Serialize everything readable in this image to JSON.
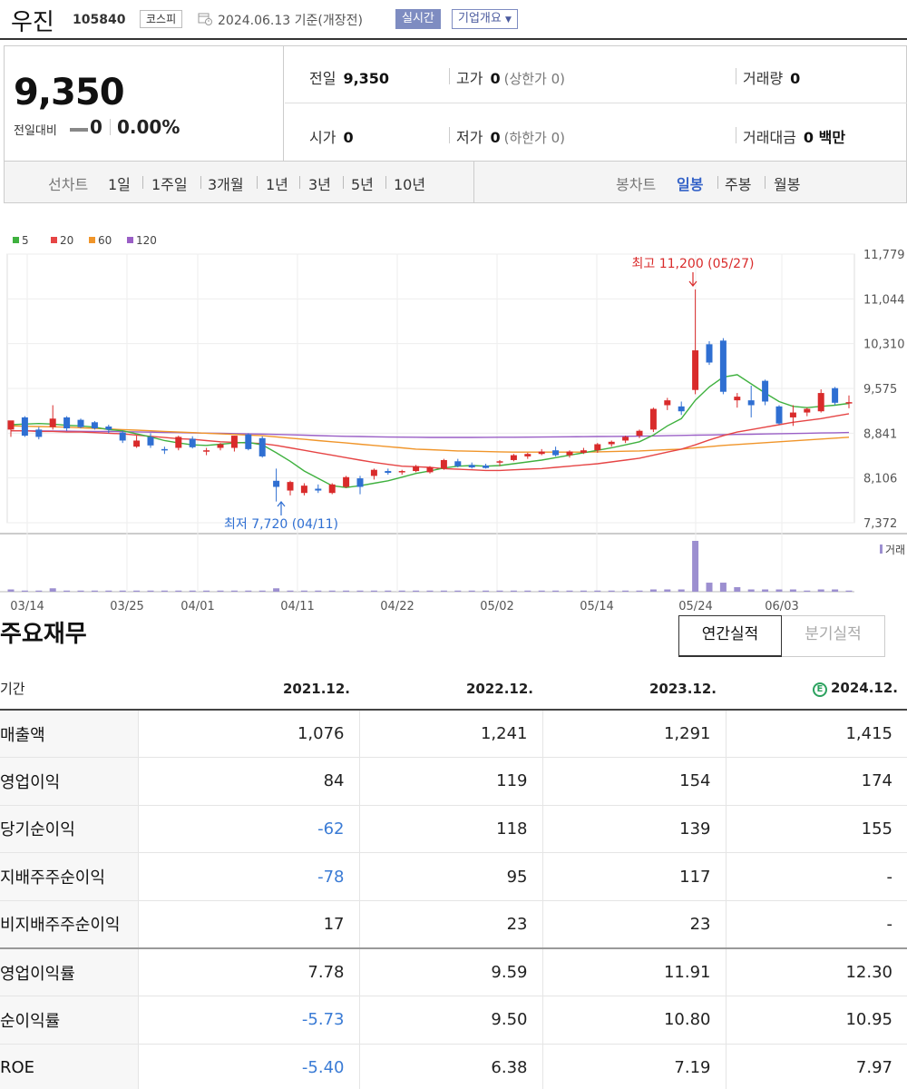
{
  "header": {
    "name": "우진",
    "code": "105840",
    "market": "코스피",
    "date": "2024.06.13",
    "basis": "기준(개장전)",
    "realtime": "실시간",
    "corp_info": "기업개요"
  },
  "price": {
    "current": "9,350",
    "change_label": "전일대비",
    "change": "0",
    "change_pct": "0.00%",
    "prev_label": "전일",
    "prev": "9,350",
    "high_label": "고가",
    "high": "0",
    "upper_limit": "(상한가 0)",
    "volume_label": "거래량",
    "volume": "0",
    "open_label": "시가",
    "open": "0",
    "low_label": "저가",
    "low": "0",
    "lower_limit": "(하한가 0)",
    "amount_label": "거래대금",
    "amount": "0 백만"
  },
  "chart_tabs": {
    "line_label": "선차트",
    "line_periods": [
      "1일",
      "1주일",
      "3개월",
      "1년",
      "3년",
      "5년",
      "10년"
    ],
    "candle_label": "봉차트",
    "candle_periods": [
      "일봉",
      "주봉",
      "월봉"
    ],
    "candle_selected": 0
  },
  "colors": {
    "up": "#d92b2b",
    "down": "#2f6fd2",
    "ma5": "#3fb13f",
    "ma20": "#e64545",
    "ma60": "#f0952a",
    "ma120": "#9a5fc6",
    "volume": "#9c8fd0"
  },
  "chart_data": {
    "type": "candlestick",
    "legend": [
      {
        "name": "5",
        "color": "#3fb13f"
      },
      {
        "name": "20",
        "color": "#e64545"
      },
      {
        "name": "60",
        "color": "#f0952a"
      },
      {
        "name": "120",
        "color": "#9a5fc6"
      }
    ],
    "y_ticks": [
      "11,779",
      "11,044",
      "10,310",
      "9,575",
      "8,841",
      "8,106",
      "7,372"
    ],
    "ylim": [
      7372,
      11779
    ],
    "x_ticks": [
      "03/14",
      "03/25",
      "04/01",
      "04/11",
      "04/22",
      "05/02",
      "05/14",
      "05/24",
      "06/03"
    ],
    "annotations": {
      "high": "최고 11,200 (05/27)",
      "low": "최저 7,720 (04/11)"
    },
    "volume_label": "거래",
    "candles": [
      {
        "o": 8900,
        "h": 9040,
        "l": 8780,
        "c": 9050
      },
      {
        "o": 9100,
        "h": 9120,
        "l": 8780,
        "c": 8800
      },
      {
        "o": 8900,
        "h": 8940,
        "l": 8740,
        "c": 8780
      },
      {
        "o": 8940,
        "h": 9300,
        "l": 8900,
        "c": 9080
      },
      {
        "o": 9100,
        "h": 9120,
        "l": 8880,
        "c": 8920
      },
      {
        "o": 9060,
        "h": 9080,
        "l": 8920,
        "c": 8940
      },
      {
        "o": 9020,
        "h": 9040,
        "l": 8900,
        "c": 8920
      },
      {
        "o": 8950,
        "h": 8980,
        "l": 8840,
        "c": 8900
      },
      {
        "o": 8850,
        "h": 8880,
        "l": 8680,
        "c": 8720
      },
      {
        "o": 8620,
        "h": 8800,
        "l": 8600,
        "c": 8720
      },
      {
        "o": 8780,
        "h": 8840,
        "l": 8600,
        "c": 8640
      },
      {
        "o": 8580,
        "h": 8620,
        "l": 8500,
        "c": 8560
      },
      {
        "o": 8600,
        "h": 8800,
        "l": 8560,
        "c": 8780
      },
      {
        "o": 8750,
        "h": 8790,
        "l": 8590,
        "c": 8610
      },
      {
        "o": 8540,
        "h": 8600,
        "l": 8480,
        "c": 8560
      },
      {
        "o": 8600,
        "h": 8680,
        "l": 8560,
        "c": 8660
      },
      {
        "o": 8600,
        "h": 8800,
        "l": 8540,
        "c": 8800
      },
      {
        "o": 8820,
        "h": 8840,
        "l": 8560,
        "c": 8580
      },
      {
        "o": 8760,
        "h": 8790,
        "l": 8440,
        "c": 8460
      },
      {
        "o": 8060,
        "h": 8260,
        "l": 7720,
        "c": 7960
      },
      {
        "o": 7900,
        "h": 8060,
        "l": 7820,
        "c": 8040
      },
      {
        "o": 7860,
        "h": 8020,
        "l": 7820,
        "c": 7980
      },
      {
        "o": 7930,
        "h": 8000,
        "l": 7860,
        "c": 7900
      },
      {
        "o": 7860,
        "h": 8020,
        "l": 7840,
        "c": 8000
      },
      {
        "o": 7960,
        "h": 8140,
        "l": 7940,
        "c": 8120
      },
      {
        "o": 8100,
        "h": 8140,
        "l": 7840,
        "c": 7960
      },
      {
        "o": 8140,
        "h": 8260,
        "l": 8080,
        "c": 8240
      },
      {
        "o": 8220,
        "h": 8260,
        "l": 8160,
        "c": 8190
      },
      {
        "o": 8200,
        "h": 8240,
        "l": 8160,
        "c": 8220
      },
      {
        "o": 8220,
        "h": 8320,
        "l": 8200,
        "c": 8300
      },
      {
        "o": 8200,
        "h": 8300,
        "l": 8180,
        "c": 8280
      },
      {
        "o": 8260,
        "h": 8420,
        "l": 8240,
        "c": 8400
      },
      {
        "o": 8380,
        "h": 8420,
        "l": 8280,
        "c": 8300
      },
      {
        "o": 8320,
        "h": 8360,
        "l": 8260,
        "c": 8280
      },
      {
        "o": 8310,
        "h": 8340,
        "l": 8260,
        "c": 8270
      },
      {
        "o": 8360,
        "h": 8400,
        "l": 8300,
        "c": 8380
      },
      {
        "o": 8400,
        "h": 8500,
        "l": 8380,
        "c": 8480
      },
      {
        "o": 8460,
        "h": 8520,
        "l": 8420,
        "c": 8500
      },
      {
        "o": 8500,
        "h": 8580,
        "l": 8480,
        "c": 8540
      },
      {
        "o": 8560,
        "h": 8620,
        "l": 8460,
        "c": 8480
      },
      {
        "o": 8480,
        "h": 8560,
        "l": 8440,
        "c": 8540
      },
      {
        "o": 8520,
        "h": 8600,
        "l": 8500,
        "c": 8560
      },
      {
        "o": 8560,
        "h": 8680,
        "l": 8520,
        "c": 8660
      },
      {
        "o": 8660,
        "h": 8720,
        "l": 8620,
        "c": 8700
      },
      {
        "o": 8720,
        "h": 8800,
        "l": 8680,
        "c": 8780
      },
      {
        "o": 8800,
        "h": 8900,
        "l": 8760,
        "c": 8880
      },
      {
        "o": 8900,
        "h": 9260,
        "l": 8860,
        "c": 9240
      },
      {
        "o": 9300,
        "h": 9420,
        "l": 9220,
        "c": 9380
      },
      {
        "o": 9280,
        "h": 9360,
        "l": 9140,
        "c": 9200
      },
      {
        "o": 9550,
        "h": 11200,
        "l": 9480,
        "c": 10200
      },
      {
        "o": 10300,
        "h": 10350,
        "l": 9960,
        "c": 10000
      },
      {
        "o": 10360,
        "h": 10400,
        "l": 9480,
        "c": 9520
      },
      {
        "o": 9380,
        "h": 9500,
        "l": 9260,
        "c": 9440
      },
      {
        "o": 9380,
        "h": 9620,
        "l": 9100,
        "c": 9300
      },
      {
        "o": 9700,
        "h": 9720,
        "l": 9300,
        "c": 9360
      },
      {
        "o": 9280,
        "h": 9300,
        "l": 8980,
        "c": 9000
      },
      {
        "o": 9100,
        "h": 9300,
        "l": 8960,
        "c": 9180
      },
      {
        "o": 9180,
        "h": 9260,
        "l": 9120,
        "c": 9240
      },
      {
        "o": 9200,
        "h": 9560,
        "l": 9180,
        "c": 9500
      },
      {
        "o": 9580,
        "h": 9600,
        "l": 9300,
        "c": 9340
      },
      {
        "o": 9350,
        "h": 9460,
        "l": 9250,
        "c": 9350
      }
    ],
    "ma5": [
      8980,
      8990,
      9000,
      8990,
      8970,
      8960,
      8940,
      8900,
      8880,
      8830,
      8780,
      8720,
      8680,
      8650,
      8640,
      8660,
      8680,
      8690,
      8650,
      8520,
      8380,
      8220,
      8100,
      7980,
      7950,
      7980,
      8020,
      8060,
      8120,
      8180,
      8220,
      8270,
      8300,
      8310,
      8300,
      8310,
      8340,
      8370,
      8400,
      8440,
      8480,
      8520,
      8560,
      8600,
      8650,
      8700,
      8810,
      8960,
      9080,
      9380,
      9600,
      9760,
      9800,
      9650,
      9500,
      9360,
      9280,
      9260,
      9280,
      9300,
      9330
    ],
    "ma20": [
      8880,
      8880,
      8870,
      8870,
      8860,
      8860,
      8850,
      8840,
      8830,
      8810,
      8790,
      8770,
      8750,
      8740,
      8720,
      8700,
      8690,
      8680,
      8670,
      8640,
      8600,
      8560,
      8520,
      8480,
      8440,
      8400,
      8360,
      8330,
      8300,
      8290,
      8280,
      8260,
      8250,
      8240,
      8230,
      8230,
      8240,
      8250,
      8260,
      8280,
      8300,
      8320,
      8340,
      8370,
      8400,
      8430,
      8480,
      8530,
      8580,
      8650,
      8730,
      8800,
      8860,
      8900,
      8940,
      8980,
      9020,
      9050,
      9080,
      9120,
      9160
    ],
    "ma60": [
      8960,
      8955,
      8950,
      8945,
      8940,
      8930,
      8920,
      8910,
      8900,
      8890,
      8880,
      8870,
      8860,
      8850,
      8840,
      8830,
      8820,
      8810,
      8800,
      8780,
      8760,
      8740,
      8720,
      8700,
      8680,
      8660,
      8640,
      8620,
      8600,
      8580,
      8570,
      8560,
      8550,
      8545,
      8540,
      8535,
      8530,
      8530,
      8530,
      8530,
      8530,
      8530,
      8535,
      8540,
      8545,
      8550,
      8560,
      8570,
      8580,
      8600,
      8620,
      8640,
      8655,
      8670,
      8685,
      8700,
      8715,
      8730,
      8745,
      8760,
      8775
    ],
    "ma120": [
      8880,
      8880,
      8878,
      8876,
      8874,
      8872,
      8870,
      8868,
      8866,
      8862,
      8858,
      8854,
      8850,
      8846,
      8842,
      8838,
      8834,
      8830,
      8826,
      8820,
      8814,
      8808,
      8802,
      8796,
      8790,
      8786,
      8782,
      8778,
      8776,
      8774,
      8772,
      8772,
      8772,
      8772,
      8773,
      8774,
      8775,
      8776,
      8778,
      8780,
      8782,
      8784,
      8786,
      8788,
      8790,
      8792,
      8796,
      8800,
      8804,
      8808,
      8812,
      8816,
      8820,
      8824,
      8828,
      8832,
      8836,
      8840,
      8844,
      8848,
      8852
    ],
    "volume": [
      2,
      1,
      1,
      3,
      1,
      1,
      1,
      1,
      1,
      1,
      1,
      1,
      1,
      1,
      1,
      1,
      1,
      1,
      1,
      3,
      1,
      1,
      1,
      1,
      1,
      1,
      1,
      1,
      1,
      1,
      1,
      1,
      1,
      1,
      1,
      1,
      1,
      1,
      1,
      1,
      1,
      1,
      1,
      1,
      1,
      1,
      2,
      2,
      2,
      45,
      8,
      8,
      4,
      2,
      2,
      2,
      2,
      1,
      2,
      2,
      1
    ]
  },
  "financials": {
    "title": "주요재무",
    "toggle_annual": "연간실적",
    "toggle_quarter": "분기실적",
    "period_label": "기간",
    "estimate_mark": "E",
    "columns": [
      "2021.12.",
      "2022.12.",
      "2023.12.",
      "2024.12."
    ],
    "rows": [
      {
        "label": "매출액",
        "values": [
          "1,076",
          "1,241",
          "1,291",
          "1,415"
        ]
      },
      {
        "label": "영업이익",
        "values": [
          "84",
          "119",
          "154",
          "174"
        ]
      },
      {
        "label": "당기순이익",
        "values": [
          "-62",
          "118",
          "139",
          "155"
        ]
      },
      {
        "label": "지배주주순이익",
        "values": [
          "-78",
          "95",
          "117",
          "-"
        ]
      },
      {
        "label": "비지배주주순이익",
        "values": [
          "17",
          "23",
          "23",
          "-"
        ]
      },
      {
        "label": "영업이익률",
        "values": [
          "7.78",
          "9.59",
          "11.91",
          "12.30"
        ]
      },
      {
        "label": "순이익률",
        "values": [
          "-5.73",
          "9.50",
          "10.80",
          "10.95"
        ]
      },
      {
        "label": "ROE",
        "values": [
          "-5.40",
          "6.38",
          "7.19",
          "7.97"
        ]
      }
    ]
  }
}
